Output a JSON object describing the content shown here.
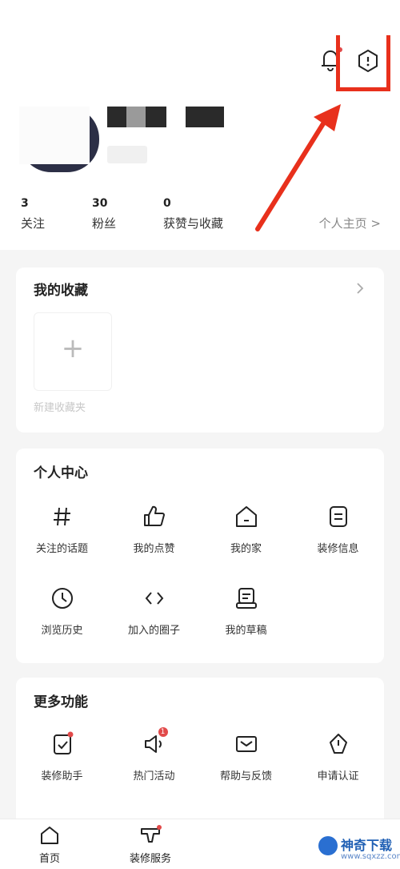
{
  "header": {
    "bell_icon": "bell-icon",
    "settings_icon": "hexagon-settings-icon"
  },
  "profile": {
    "stats": [
      {
        "count": "3",
        "label": "关注"
      },
      {
        "count": "30",
        "label": "粉丝"
      },
      {
        "count": "0",
        "label": "获赞与收藏"
      }
    ],
    "home_link": "个人主页 >"
  },
  "favorites": {
    "title": "我的收藏",
    "add_label": "新建收藏夹"
  },
  "personal_center": {
    "title": "个人中心",
    "items": [
      {
        "label": "关注的话题",
        "icon": "hashtag-icon"
      },
      {
        "label": "我的点赞",
        "icon": "thumbs-up-icon"
      },
      {
        "label": "我的家",
        "icon": "home-icon"
      },
      {
        "label": "装修信息",
        "icon": "document-icon"
      },
      {
        "label": "浏览历史",
        "icon": "clock-icon"
      },
      {
        "label": "加入的圈子",
        "icon": "code-icon"
      },
      {
        "label": "我的草稿",
        "icon": "draft-icon"
      }
    ]
  },
  "more": {
    "title": "更多功能",
    "items": [
      {
        "label": "装修助手",
        "icon": "clipboard-check-icon"
      },
      {
        "label": "热门活动",
        "icon": "megaphone-icon",
        "badge": "1"
      },
      {
        "label": "帮助与反馈",
        "icon": "mail-icon"
      },
      {
        "label": "申请认证",
        "icon": "badge-icon"
      }
    ]
  },
  "bottom_nav": [
    {
      "label": "首页",
      "icon": "home-icon"
    },
    {
      "label": "装修服务",
      "icon": "service-icon"
    }
  ],
  "watermark": {
    "title": "神奇下载",
    "url": "www.sqxzz.com"
  },
  "colors": {
    "accent_red": "#e8301c",
    "badge_red": "#e24a4a",
    "watermark_blue": "#1f5fb4"
  }
}
